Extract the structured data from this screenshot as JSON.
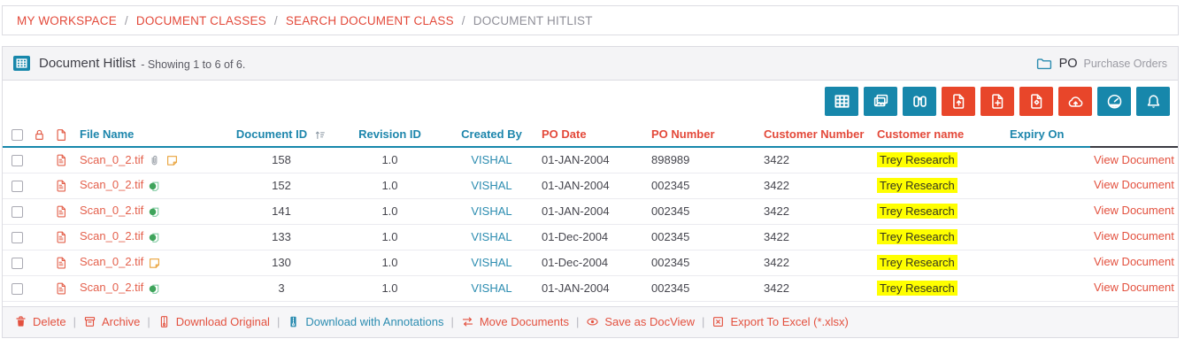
{
  "breadcrumb": {
    "separator": "/",
    "items": [
      {
        "label": "MY WORKSPACE",
        "link": true
      },
      {
        "label": "DOCUMENT CLASSES",
        "link": true
      },
      {
        "label": "SEARCH DOCUMENT CLASS",
        "link": true
      },
      {
        "label": "DOCUMENT HITLIST",
        "link": false
      }
    ]
  },
  "panel_header": {
    "title": "Document Hitlist",
    "subtitle": "- Showing 1 to 6 of 6.",
    "doc_class_code": "PO",
    "doc_class_name": "Purchase Orders"
  },
  "toolbar": {
    "buttons": [
      {
        "name": "grid-view",
        "icon": "grid",
        "color": "blue"
      },
      {
        "name": "image-view",
        "icon": "images",
        "color": "blue"
      },
      {
        "name": "search-documents",
        "icon": "binoculars",
        "color": "blue"
      },
      {
        "name": "upload-document",
        "icon": "file-upload",
        "color": "red"
      },
      {
        "name": "add-document",
        "icon": "file-plus",
        "color": "red"
      },
      {
        "name": "checkin-document",
        "icon": "file-diamond",
        "color": "red"
      },
      {
        "name": "cloud-upload",
        "icon": "cloud-upload",
        "color": "red"
      },
      {
        "name": "dashboard",
        "icon": "gauge",
        "color": "blue"
      },
      {
        "name": "notifications",
        "icon": "bell",
        "color": "blue"
      }
    ]
  },
  "table": {
    "columns": [
      {
        "type": "checkbox"
      },
      {
        "type": "icon",
        "icon": "lock"
      },
      {
        "type": "icon",
        "icon": "doc"
      },
      {
        "type": "text",
        "label": "File Name",
        "color": "blue",
        "align": "left"
      },
      {
        "type": "text",
        "label": "Document ID",
        "color": "blue",
        "align": "center",
        "sort": true
      },
      {
        "type": "text",
        "label": "Revision ID",
        "color": "blue",
        "align": "center"
      },
      {
        "type": "text",
        "label": "Created By",
        "color": "blue",
        "align": "center"
      },
      {
        "type": "text",
        "label": "PO Date",
        "color": "red",
        "align": "left"
      },
      {
        "type": "text",
        "label": "PO Number",
        "color": "red",
        "align": "left"
      },
      {
        "type": "text",
        "label": "Customer Number",
        "color": "red",
        "align": "left"
      },
      {
        "type": "text",
        "label": "Customer name",
        "color": "red",
        "align": "left"
      },
      {
        "type": "text",
        "label": "Expiry On",
        "color": "blue",
        "align": "left"
      },
      {
        "type": "actions",
        "label": ""
      }
    ],
    "rows": [
      {
        "file_name": "Scan_0_2.tif",
        "attachments": [
          "paperclip",
          "sticky-note"
        ],
        "document_id": "158",
        "revision_id": "1.0",
        "created_by": "VISHAL",
        "po_date": "01-JAN-2004",
        "po_number": "898989",
        "customer_number": "3422",
        "customer_name": "Trey Research",
        "expiry_on": "",
        "action": "View Document"
      },
      {
        "file_name": "Scan_0_2.tif",
        "attachments": [
          "annotation"
        ],
        "document_id": "152",
        "revision_id": "1.0",
        "created_by": "VISHAL",
        "po_date": "01-JAN-2004",
        "po_number": "002345",
        "customer_number": "3422",
        "customer_name": "Trey Research",
        "expiry_on": "",
        "action": "View Document"
      },
      {
        "file_name": "Scan_0_2.tif",
        "attachments": [
          "annotation"
        ],
        "document_id": "141",
        "revision_id": "1.0",
        "created_by": "VISHAL",
        "po_date": "01-JAN-2004",
        "po_number": "002345",
        "customer_number": "3422",
        "customer_name": "Trey Research",
        "expiry_on": "",
        "action": "View Document"
      },
      {
        "file_name": "Scan_0_2.tif",
        "attachments": [
          "annotation"
        ],
        "document_id": "133",
        "revision_id": "1.0",
        "created_by": "VISHAL",
        "po_date": "01-Dec-2004",
        "po_number": "002345",
        "customer_number": "3422",
        "customer_name": "Trey Research",
        "expiry_on": "",
        "action": "View Document"
      },
      {
        "file_name": "Scan_0_2.tif",
        "attachments": [
          "sticky-note"
        ],
        "document_id": "130",
        "revision_id": "1.0",
        "created_by": "VISHAL",
        "po_date": "01-Dec-2004",
        "po_number": "002345",
        "customer_number": "3422",
        "customer_name": "Trey Research",
        "expiry_on": "",
        "action": "View Document"
      },
      {
        "file_name": "Scan_0_2.tif",
        "attachments": [
          "annotation"
        ],
        "document_id": "3",
        "revision_id": "1.0",
        "created_by": "VISHAL",
        "po_date": "01-JAN-2004",
        "po_number": "002345",
        "customer_number": "3422",
        "customer_name": "Trey Research",
        "expiry_on": "",
        "action": "View Document"
      }
    ]
  },
  "footer": {
    "separator": "|",
    "actions": [
      {
        "label": "Delete",
        "icon": "trash",
        "color": "red"
      },
      {
        "label": "Archive",
        "icon": "archive",
        "color": "red"
      },
      {
        "label": "Download Original",
        "icon": "zip",
        "color": "red"
      },
      {
        "label": "Download with Annotations",
        "icon": "zip-filled",
        "color": "blue"
      },
      {
        "label": "Move Documents",
        "icon": "move",
        "color": "red"
      },
      {
        "label": "Save as DocView",
        "icon": "eye",
        "color": "red"
      },
      {
        "label": "Export To Excel (*.xlsx)",
        "icon": "excel",
        "color": "red"
      }
    ]
  },
  "colors": {
    "accent_red": "#e8462a",
    "accent_blue": "#1787ab",
    "link_red": "#e3513f",
    "header_blue": "#1d86ac",
    "highlight_yellow": "#ffff00"
  }
}
